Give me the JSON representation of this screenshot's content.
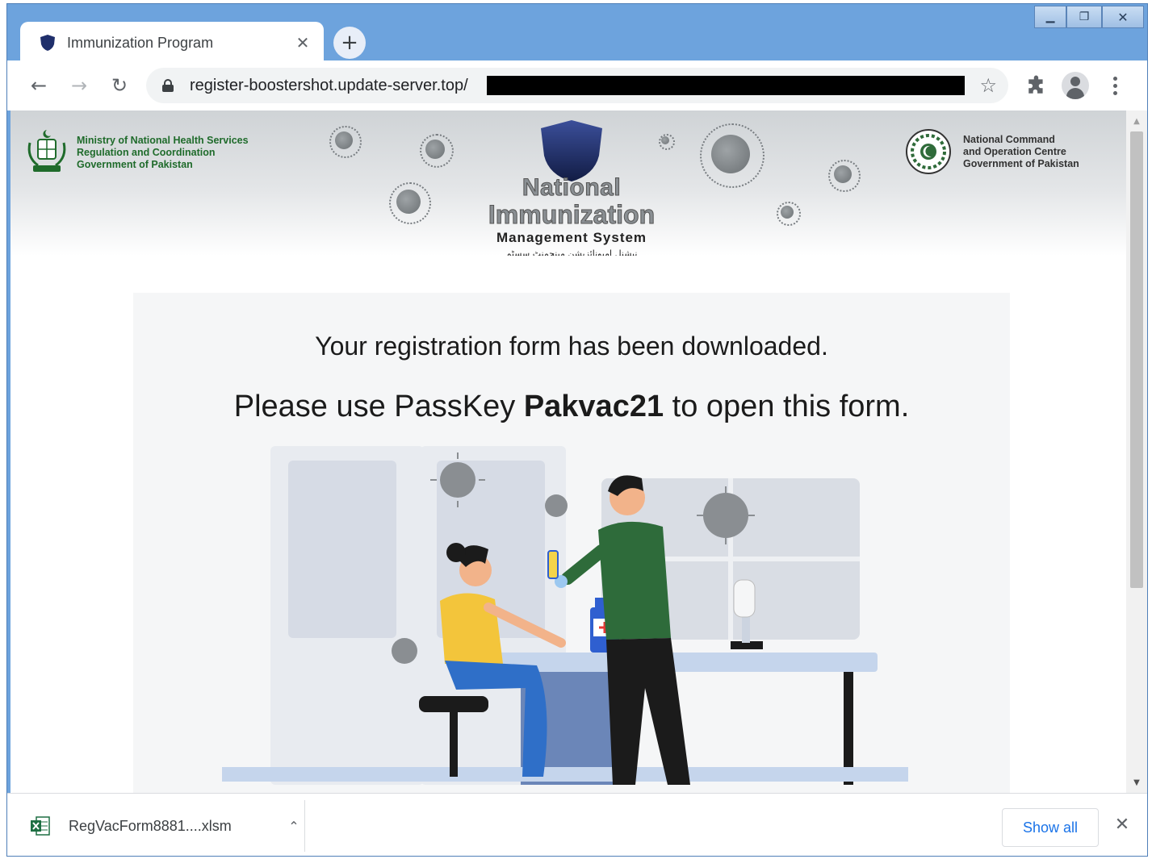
{
  "window": {
    "minimize_glyph": "▁",
    "maximize_glyph": "❐",
    "close_glyph": "✕"
  },
  "tab": {
    "title": "Immunization Program",
    "close_glyph": "✕",
    "new_tab_glyph": "+"
  },
  "toolbar": {
    "back_glyph": "←",
    "forward_glyph": "→",
    "reload_glyph": "↻",
    "url": "register-boostershot.update-server.top/",
    "bookmark_glyph": "☆"
  },
  "banner": {
    "left_org": {
      "line1": "Ministry of National Health Services",
      "line2": "Regulation and Coordination",
      "line3": "Government of Pakistan"
    },
    "center": {
      "line1": "National",
      "line2": "Immunization",
      "line3": "Management System",
      "urdu": "نیشنل امیونائزیشن مینجمنٹ سسٹم"
    },
    "right_org": {
      "line1": "National Command",
      "line2": "and Operation Centre",
      "line3": "Government of Pakistan"
    }
  },
  "content": {
    "message1": "Your registration form has been downloaded.",
    "message2_prefix": "Please use PassKey ",
    "passkey": "Pakvac21",
    "message2_suffix": " to open this form."
  },
  "scrollbar": {
    "up_glyph": "▲",
    "down_glyph": "▼"
  },
  "download_bar": {
    "file_name": "RegVacForm8881....xlsm",
    "chevron_glyph": "⌃",
    "show_all_label": "Show all",
    "close_glyph": "✕"
  },
  "colors": {
    "window_frame": "#6da3dd",
    "link_blue": "#1a73e8",
    "ministry_green": "#1f6b2b",
    "shield_navy": "#1f2f6b",
    "crescent_red": "#c62828",
    "doctor_shirt": "#2e6b3a",
    "patient_shirt": "#f3c53b",
    "patient_pants": "#2f6fc8"
  }
}
